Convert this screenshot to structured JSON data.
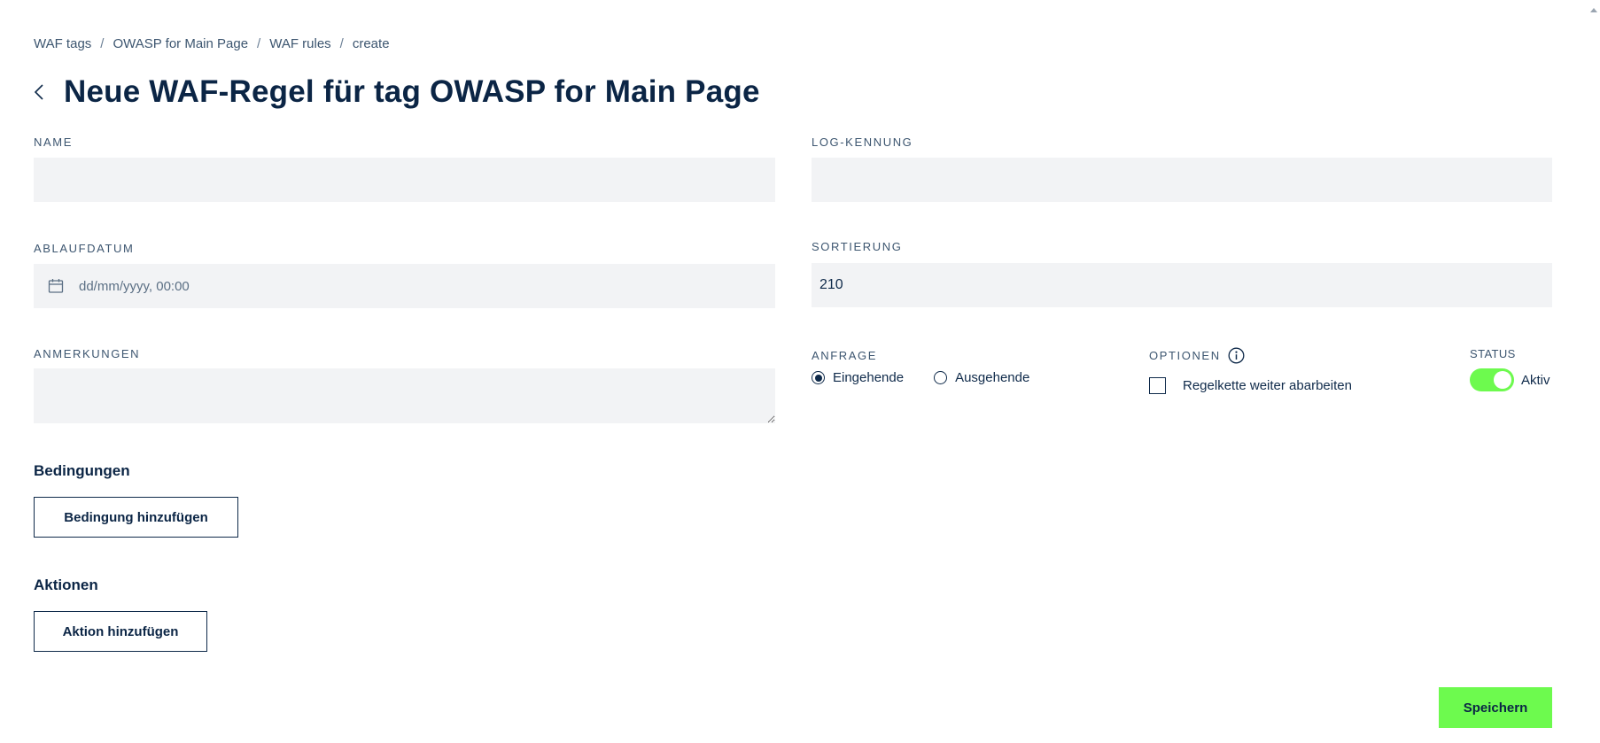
{
  "breadcrumb": {
    "items": [
      "WAF tags",
      "OWASP for Main Page",
      "WAF rules",
      "create"
    ],
    "separator": "/"
  },
  "header": {
    "title": "Neue WAF-Regel für tag OWASP for Main Page"
  },
  "form": {
    "name": {
      "label": "NAME",
      "value": ""
    },
    "log_id": {
      "label": "LOG-KENNUNG",
      "value": ""
    },
    "expiry": {
      "label": "ABLAUFDATUM",
      "placeholder": "dd/mm/yyyy, 00:00",
      "icon": "calendar-icon"
    },
    "sorting": {
      "label": "SORTIERUNG",
      "value": "210"
    },
    "notes": {
      "label": "ANMERKUNGEN",
      "value": ""
    },
    "request": {
      "label": "ANFRAGE",
      "options": [
        "Eingehende",
        "Ausgehende"
      ],
      "selected": "Eingehende"
    },
    "options": {
      "label": "OPTIONEN",
      "icon": "info-icon",
      "checkbox_label": "Regelkette weiter abarbeiten",
      "checked": false
    },
    "status": {
      "label": "STATUS",
      "value_label": "Aktiv",
      "on": true
    }
  },
  "conditions": {
    "title": "Bedingungen",
    "add_label": "Bedingung hinzufügen"
  },
  "actions": {
    "title": "Aktionen",
    "add_label": "Aktion hinzufügen"
  },
  "footer": {
    "save_label": "Speichern"
  },
  "colors": {
    "accent": "#6dfa4e",
    "primary_text": "#0b2545",
    "field_bg": "#f2f3f5"
  }
}
